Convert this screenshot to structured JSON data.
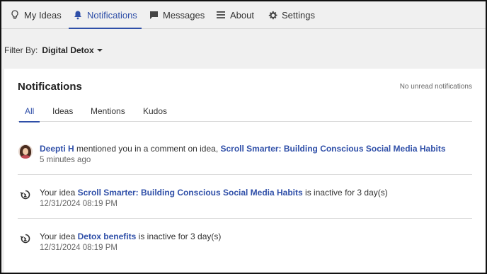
{
  "nav": {
    "items": [
      {
        "label": "My Ideas",
        "icon": "lightbulb-icon"
      },
      {
        "label": "Notifications",
        "icon": "bell-icon",
        "active": true
      },
      {
        "label": "Messages",
        "icon": "chat-bubble-icon"
      },
      {
        "label": "About",
        "icon": "menu-lines-icon"
      },
      {
        "label": "Settings",
        "icon": "gear-icon"
      }
    ],
    "active_color": "#2f4fa8"
  },
  "filter": {
    "label": "Filter By:",
    "value": "Digital Detox"
  },
  "card": {
    "title": "Notifications",
    "status": "No unread notifications",
    "tabs": [
      {
        "label": "All",
        "active": true
      },
      {
        "label": "Ideas"
      },
      {
        "label": "Mentions"
      },
      {
        "label": "Kudos"
      }
    ]
  },
  "notifications": [
    {
      "icon": "user-avatar",
      "actor": "Deepti H",
      "text": "mentioned you in a comment on idea,",
      "idea": "Scroll Smarter: Building Conscious Social Media Habits",
      "time": "5 minutes ago"
    },
    {
      "icon": "inactive-idea-icon",
      "prefix": "Your idea",
      "idea": "Scroll Smarter: Building Conscious Social Media Habits",
      "suffix": "is inactive for 3 day(s)",
      "time": "12/31/2024 08:19 PM"
    },
    {
      "icon": "inactive-idea-icon",
      "prefix": "Your idea",
      "idea": "Detox benefits",
      "suffix": "is inactive for 3 day(s)",
      "time": "12/31/2024 08:19 PM"
    }
  ]
}
